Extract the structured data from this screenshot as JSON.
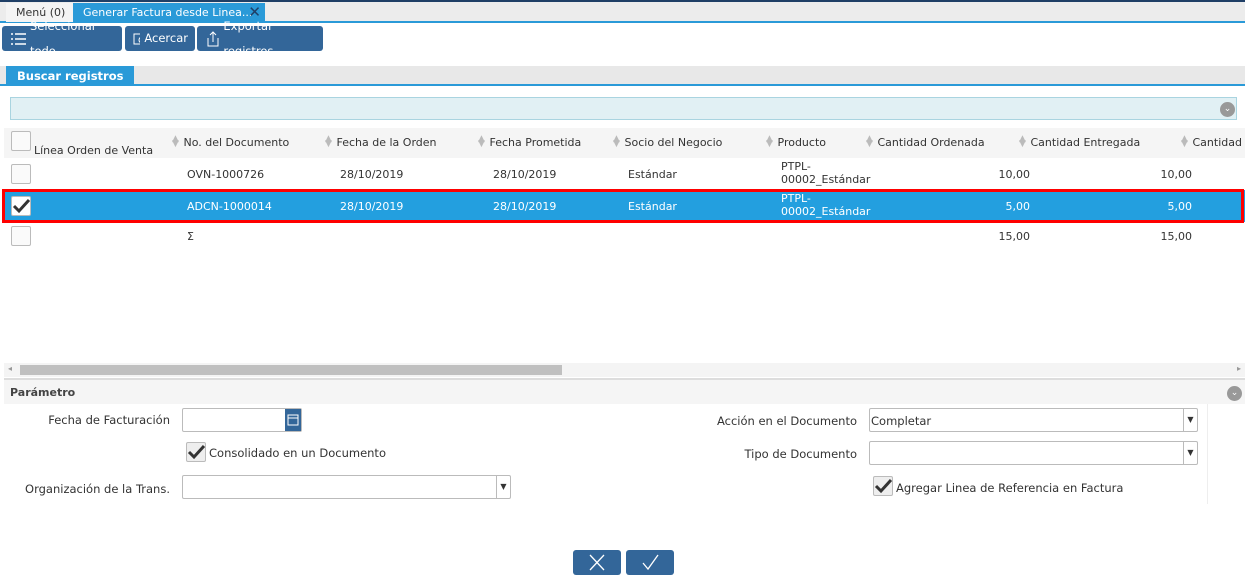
{
  "tabs": [
    {
      "label": "Menú (0)"
    },
    {
      "label": "Generar Factura desde Linea..."
    }
  ],
  "toolbar": {
    "select_all": "Seleccionar todo",
    "zoom": "Acercar",
    "export": "Exportar registros"
  },
  "search_tab": "Buscar registros",
  "grid": {
    "columns": [
      "Línea Orden de Venta",
      "No. del Documento",
      "Fecha de la Orden",
      "Fecha Prometida",
      "Socio del Negocio",
      "Producto",
      "Cantidad Ordenada",
      "Cantidad Entregada",
      "Cantidad I"
    ],
    "rows": [
      {
        "checked": false,
        "selected": false,
        "doc": "OVN-1000726",
        "order_date": "28/10/2019",
        "promised": "28/10/2019",
        "partner": "Estándar",
        "product_1": "PTPL-",
        "product_2": "00002_Estándar",
        "qty_ordered": "10,00",
        "qty_delivered": "10,00"
      },
      {
        "checked": true,
        "selected": true,
        "doc": "ADCN-1000014",
        "order_date": "28/10/2019",
        "promised": "28/10/2019",
        "partner": "Estándar",
        "product_1": "PTPL-",
        "product_2": "00002_Estándar",
        "qty_ordered": "5,00",
        "qty_delivered": "5,00"
      }
    ],
    "total": {
      "symbol": "Σ",
      "qty_ordered": "15,00",
      "qty_delivered": "15,00"
    }
  },
  "params": {
    "title": "Parámetro",
    "invoice_date_label": "Fecha de Facturación",
    "invoice_date": "",
    "consolidated_label": "Consolidado en un Documento",
    "consolidated": true,
    "org_label": "Organización de la Trans.",
    "org": "",
    "doc_action_label": "Acción en el Documento",
    "doc_action": "Completar",
    "doc_type_label": "Tipo de Documento",
    "doc_type": "",
    "add_ref_label": "Agregar Linea de Referencia en Factura",
    "add_ref": true
  },
  "colors": {
    "accent": "#2a9ad8",
    "button": "#336699",
    "selection": "#239fdf",
    "highlight": "#ff0000"
  }
}
